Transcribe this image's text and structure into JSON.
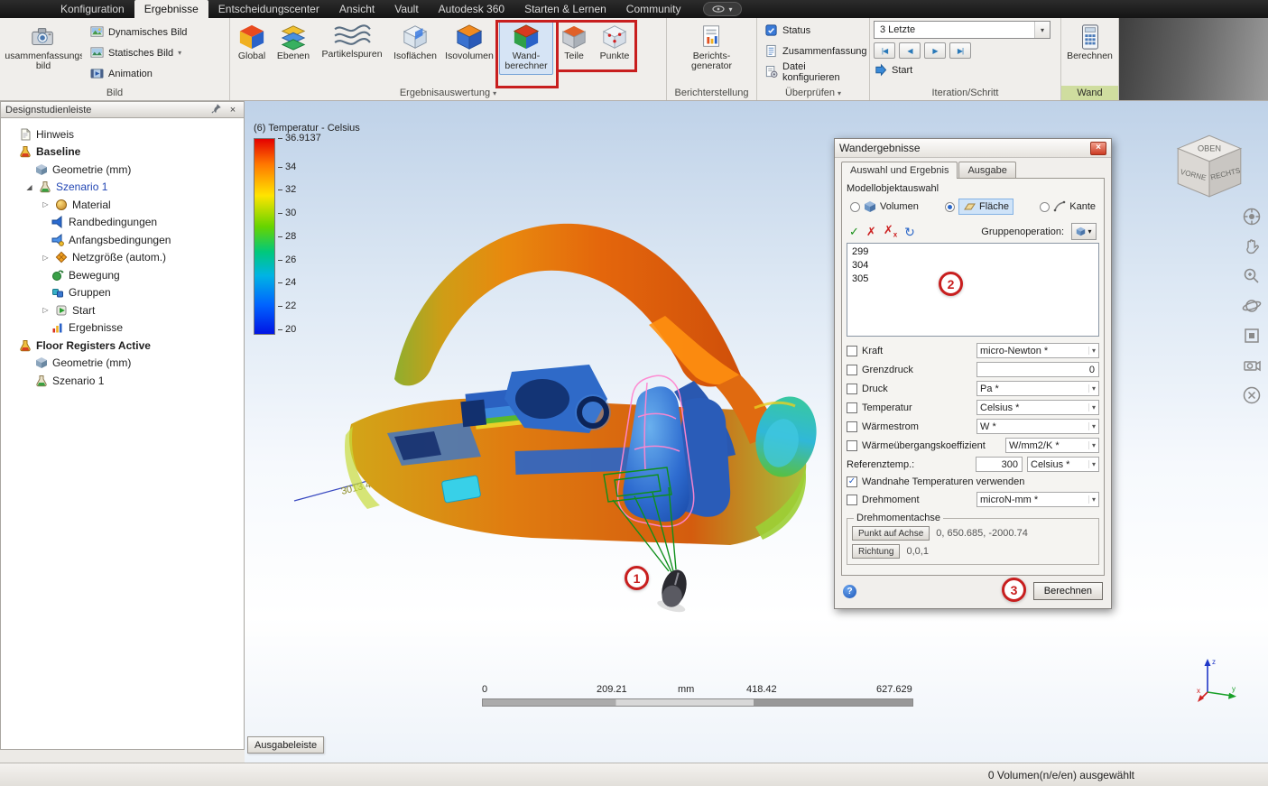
{
  "menubar": {
    "tabs": [
      "Konfiguration",
      "Ergebnisse",
      "Entscheidungscenter",
      "Ansicht",
      "Vault",
      "Autodesk 360",
      "Starten &amp;#x20;Lernen",
      "Community"
    ],
    "tab_starten": "Starten & Lernen"
  },
  "ribbon": {
    "bild": {
      "label": "Bild",
      "summary": "Zusammenfassungs-bild",
      "dynamic": "Dynamisches Bild",
      "static": "Statisches Bild",
      "animation": "Animation"
    },
    "ergebnis": {
      "label": "Ergebnisauswertung",
      "global": "Global",
      "ebenen": "Ebenen",
      "partikelspuren": "Partikelspuren",
      "isoflaechen": "Isoflächen",
      "isovolumen": "Isovolumen",
      "wandberechner": "Wand-berechner",
      "teile": "Teile",
      "punkte": "Punkte"
    },
    "bericht": {
      "label": "Berichterstellung",
      "generator": "Berichts-generator"
    },
    "ueberpruefen": {
      "label": "Überprüfen",
      "status": "Status",
      "zusammenfassung": "Zusammenfassung",
      "datei": "Datei konfigurieren"
    },
    "iteration": {
      "label": "Iteration/Schritt",
      "dropdown": "3 Letzte",
      "start": "Start"
    },
    "wand": {
      "label": "Wand",
      "berechnen": "Berechnen"
    }
  },
  "sidebar": {
    "title": "Designstudienleiste",
    "tree": [
      {
        "label": "Hinweis"
      },
      {
        "label": "Baseline"
      },
      {
        "label": "Geometrie (mm)"
      },
      {
        "label": "Szenario 1"
      },
      {
        "label": "Material"
      },
      {
        "label": "Randbedingungen"
      },
      {
        "label": "Anfangsbedingungen"
      },
      {
        "label": "Netzgröße (autom.)"
      },
      {
        "label": "Bewegung"
      },
      {
        "label": "Gruppen"
      },
      {
        "label": "Start"
      },
      {
        "label": "Ergebnisse"
      },
      {
        "label": "Floor Registers Active"
      },
      {
        "label": "Geometrie (mm)"
      },
      {
        "label": "Szenario 1"
      }
    ]
  },
  "viewport": {
    "legend": {
      "title": "(6) Temperatur - Celsius",
      "max": "36.9137",
      "ticks": [
        "34",
        "32",
        "30",
        "28",
        "26",
        "24",
        "22",
        "20"
      ]
    },
    "measurement_label": "3013.45",
    "scalebar": {
      "zero": "0",
      "v1": "209.21",
      "unit": "mm",
      "v2": "418.42",
      "v3": "627.629"
    },
    "output_bar": "Ausgabeleiste",
    "viewcube": {
      "top": "OBEN",
      "front": "VORNE",
      "right": "RECHTS"
    },
    "triad": {
      "x": "x",
      "y": "y",
      "z": "z"
    }
  },
  "dialog": {
    "title": "Wandergebnisse",
    "tab_selection": "Auswahl und Ergebnis",
    "tab_output": "Ausgabe",
    "model_selection_label": "Modellobjektauswahl",
    "radio_volume": "Volumen",
    "radio_face": "Fläche",
    "radio_edge": "Kante",
    "group_operation_label": "Gruppenoperation:",
    "list_items": [
      "299",
      "304",
      "305"
    ],
    "rows": [
      {
        "label": "Kraft",
        "value": "micro-Newton *"
      },
      {
        "label": "Grenzdruck",
        "value": "0"
      },
      {
        "label": "Druck",
        "value": "Pa *"
      },
      {
        "label": "Temperatur",
        "value": "Celsius *"
      },
      {
        "label": "Wärmestrom",
        "value": "W *"
      },
      {
        "label": "Wärmeübergangskoeffizient",
        "value": "W/mm2/K *"
      }
    ],
    "reference_label": "Referenztemp.:",
    "reference_value": "300",
    "reference_unit": "Celsius *",
    "near_wall_label": "Wandnahe Temperaturen verwenden",
    "torque_label": "Drehmoment",
    "torque_unit": "microN-mm *",
    "torque_axis_label": "Drehmomentachse",
    "point_button": "Punkt auf Achse",
    "point_value": "0, 650.685, -2000.74",
    "direction_button": "Richtung",
    "direction_value": "0,0,1",
    "calculate": "Berechnen"
  },
  "annotations": {
    "c1": "1",
    "c2": "2",
    "c3": "3"
  },
  "statusbar": {
    "selection": "0 Volumen(n/e/en) ausgewählt"
  },
  "icons": {
    "close": "×",
    "help": "?",
    "check": "✓",
    "cross": "✗",
    "sub_x": "x",
    "refresh": "↻",
    "dropdown": "▾",
    "expander_open": "◢",
    "expander_closed": "▷",
    "skip_back": "|◀",
    "step_back": "◀",
    "step_fwd": "▶",
    "skip_fwd": "▶|"
  },
  "colors": {
    "annotation": "#c81e1e",
    "selection": "#cfe3f8",
    "accent": "#2a66c8"
  }
}
